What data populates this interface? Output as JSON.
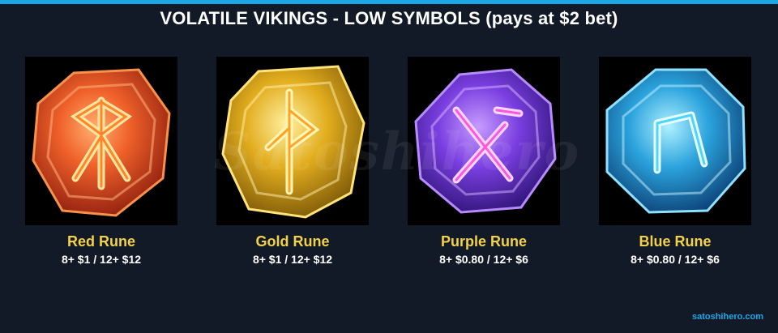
{
  "title": "VOLATILE VIKINGS - LOW SYMBOLS (pays at $2 bet)",
  "watermark": "Satoshihero",
  "symbols": [
    {
      "name": "Red Rune",
      "pays": "8+ $1 / 12+ $12",
      "icon": "red-rune-icon",
      "color": "#e4471f"
    },
    {
      "name": "Gold Rune",
      "pays": "8+ $1 / 12+ $12",
      "icon": "gold-rune-icon",
      "color": "#e6b21f"
    },
    {
      "name": "Purple Rune",
      "pays": "8+ $0.80 / 12+ $6",
      "icon": "purple-rune-icon",
      "color": "#7a3ee0"
    },
    {
      "name": "Blue Rune",
      "pays": "8+ $0.80 / 12+ $6",
      "icon": "blue-rune-icon",
      "color": "#2aa2dc"
    }
  ],
  "credit": "satoshihero.com",
  "colors": {
    "background": "#131a27",
    "accent": "#1aa7e8",
    "label": "#f3d24a"
  }
}
